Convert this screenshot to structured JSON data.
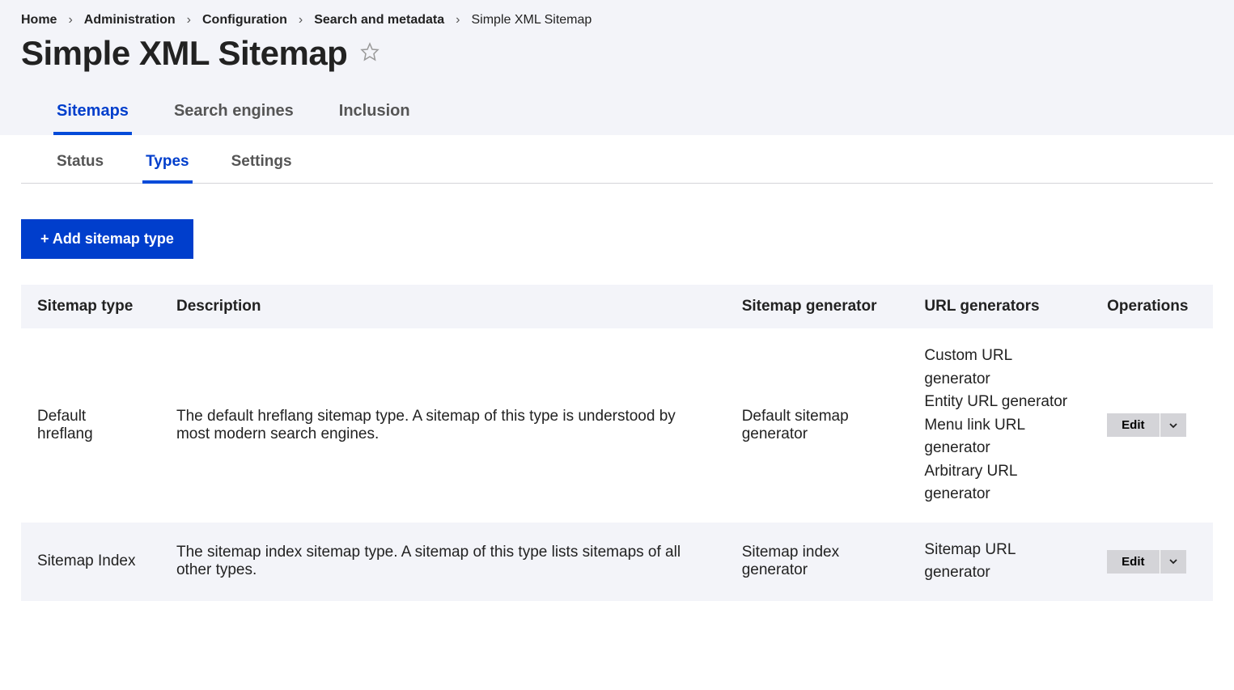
{
  "breadcrumb": [
    {
      "label": "Home"
    },
    {
      "label": "Administration"
    },
    {
      "label": "Configuration"
    },
    {
      "label": "Search and metadata"
    },
    {
      "label": "Simple XML Sitemap",
      "current": true
    }
  ],
  "page_title": "Simple XML Sitemap",
  "primary_tabs": {
    "sitemaps": "Sitemaps",
    "search_engines": "Search engines",
    "inclusion": "Inclusion"
  },
  "secondary_tabs": {
    "status": "Status",
    "types": "Types",
    "settings": "Settings"
  },
  "add_button": "+ Add sitemap type",
  "table": {
    "headers": {
      "type": "Sitemap type",
      "description": "Description",
      "generator": "Sitemap generator",
      "url_generators": "URL generators",
      "operations": "Operations"
    },
    "rows": [
      {
        "type": "Default hreflang",
        "description": "The default hreflang sitemap type. A sitemap of this type is understood by most modern search engines.",
        "generator": "Default sitemap generator",
        "url_generators": "Custom URL generator\nEntity URL generator\nMenu link URL generator\nArbitrary URL generator",
        "edit": "Edit"
      },
      {
        "type": "Sitemap Index",
        "description": "The sitemap index sitemap type. A sitemap of this type lists sitemaps of all other types.",
        "generator": "Sitemap index generator",
        "url_generators": "Sitemap URL generator",
        "edit": "Edit"
      }
    ]
  }
}
